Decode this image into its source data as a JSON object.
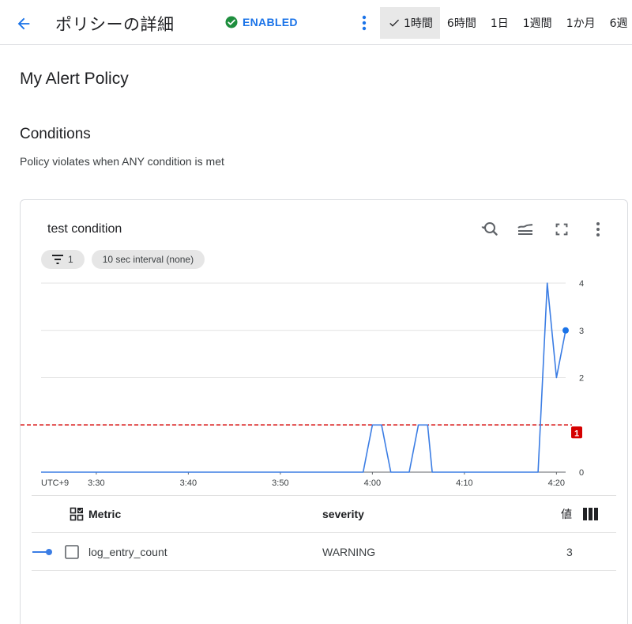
{
  "header": {
    "title": "ポリシーの詳細",
    "status_label": "ENABLED",
    "time_ranges": [
      "1時間",
      "6時間",
      "1日",
      "1週間",
      "1か月",
      "6週"
    ],
    "selected_range": "1時間"
  },
  "policy": {
    "name": "My Alert Policy",
    "conditions_title": "Conditions",
    "conditions_subtitle": "Policy violates when ANY condition is met"
  },
  "condition_card": {
    "title": "test condition",
    "filter_chip": "1",
    "interval_chip": "10 sec interval (none)"
  },
  "chart_data": {
    "type": "line",
    "timezone_label": "UTC+9",
    "x_tick_labels": [
      "3:30",
      "3:40",
      "3:50",
      "4:00",
      "4:10",
      "4:20"
    ],
    "y_tick_labels": [
      "0",
      "1",
      "2",
      "3",
      "4"
    ],
    "ylim": [
      0,
      4
    ],
    "x_range": [
      "3:24",
      "4:21"
    ],
    "threshold": {
      "value": 1,
      "label": "1",
      "color": "#d50000",
      "style": "dashed"
    },
    "series": [
      {
        "name": "log_entry_count",
        "color": "#3b7de4",
        "x": [
          "3:24",
          "3:59",
          "3:59.5",
          "4:00",
          "4:01",
          "4:01.5",
          "4:02",
          "4:04",
          "4:04.5",
          "4:05",
          "4:06",
          "4:06.5",
          "4:18",
          "4:19",
          "4:20",
          "4:21"
        ],
        "values": [
          0,
          0,
          0.5,
          1,
          1,
          0.5,
          0,
          0,
          0.5,
          1,
          1,
          0,
          0,
          4,
          2,
          3
        ]
      }
    ]
  },
  "legend": {
    "headers": {
      "metric": "Metric",
      "severity": "severity",
      "value": "値"
    },
    "rows": [
      {
        "metric": "log_entry_count",
        "severity": "WARNING",
        "value": "3"
      }
    ]
  },
  "colors": {
    "accent": "#1a73e8",
    "enabled": "#1e8e3e",
    "threshold": "#d50000"
  }
}
